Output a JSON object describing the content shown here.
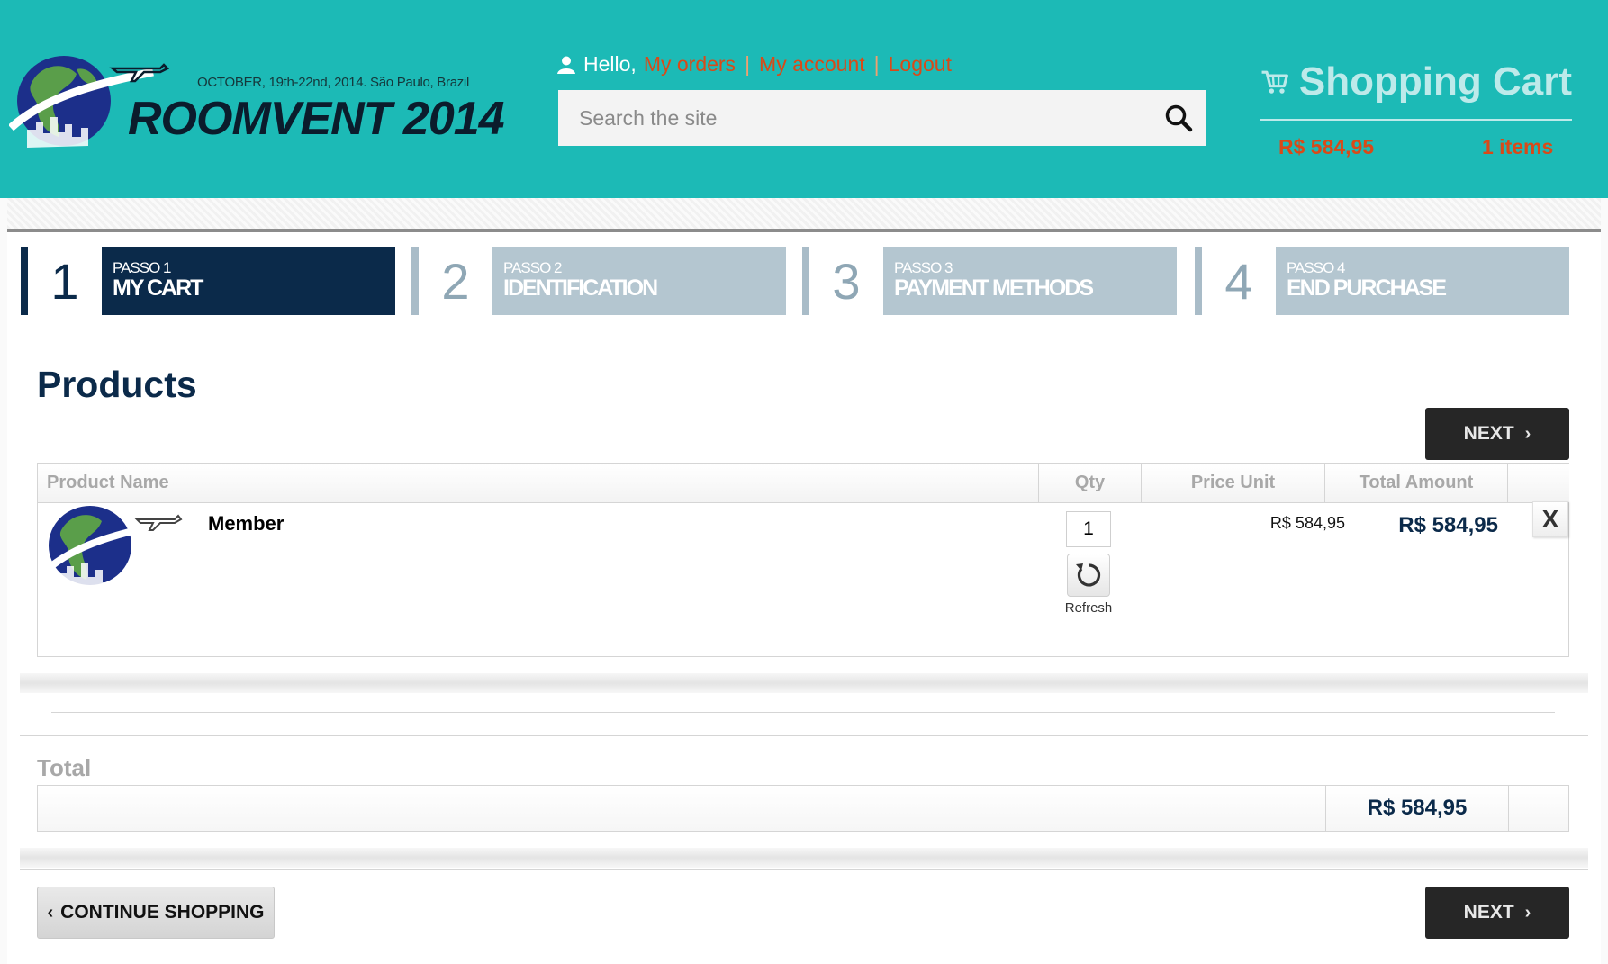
{
  "header": {
    "event_date": "OCTOBER, 19th-22nd, 2014. São Paulo, Brazil",
    "brand": "ROOMVENT 2014",
    "greeting": "Hello,",
    "links": {
      "orders": "My orders",
      "account": "My account",
      "logout": "Logout"
    },
    "separator": "|",
    "search_placeholder": "Search the site"
  },
  "cart": {
    "title": "Shopping Cart",
    "amount": "R$ 584,95",
    "items": "1 items"
  },
  "steps": [
    {
      "number": "1",
      "passo": "PASSO 1",
      "name": "MY CART",
      "active": true
    },
    {
      "number": "2",
      "passo": "PASSO 2",
      "name": "IDENTIFICATION",
      "active": false
    },
    {
      "number": "3",
      "passo": "PASSO 3",
      "name": "PAYMENT METHODS",
      "active": false
    },
    {
      "number": "4",
      "passo": "PASSO 4",
      "name": "END PURCHASE",
      "active": false
    }
  ],
  "products_heading": "Products",
  "next_label": "NEXT",
  "table": {
    "headers": {
      "name": "Product Name",
      "qty": "Qty",
      "price_unit": "Price Unit",
      "total": "Total Amount"
    },
    "rows": [
      {
        "name": "Member",
        "qty": "1",
        "refresh": "Refresh",
        "price_unit": "R$ 584,95",
        "total": "R$ 584,95",
        "remove": "X"
      }
    ]
  },
  "total_heading": "Total",
  "total_value": "R$ 584,95",
  "continue_label": "CONTINUE SHOPPING",
  "colors": {
    "header": "#1cbab6",
    "accent": "#d94a18",
    "navy": "#0b2a4a",
    "step_inactive": "#b4c6d0"
  }
}
